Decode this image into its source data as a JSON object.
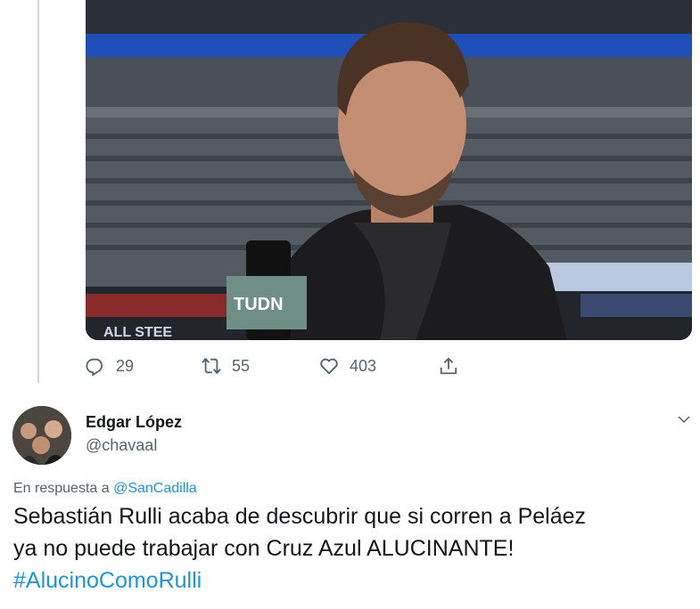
{
  "tweet_stats": {
    "replies": "29",
    "retweets": "55",
    "likes": "403"
  },
  "media": {
    "mic_flag_text": "TUDN",
    "banner_text": "ALL STEE"
  },
  "reply_tweet": {
    "display_name": "Edgar López",
    "handle": "@chavaal",
    "reply_prefix": "En respuesta a",
    "reply_mention": "@SanCadilla",
    "line1": "Sebastián Rulli acaba de descubrir que si corren a Peláez",
    "line2": "ya no puede trabajar con Cruz Azul ALUCINANTE!",
    "hashtag": "#AlucinoComoRulli"
  },
  "colors": {
    "link": "#1b95e0",
    "secondary": "#536471",
    "primary_text": "#14171a"
  },
  "icons": [
    "reply-icon",
    "retweet-icon",
    "like-icon",
    "share-icon",
    "chevron-down-icon"
  ]
}
